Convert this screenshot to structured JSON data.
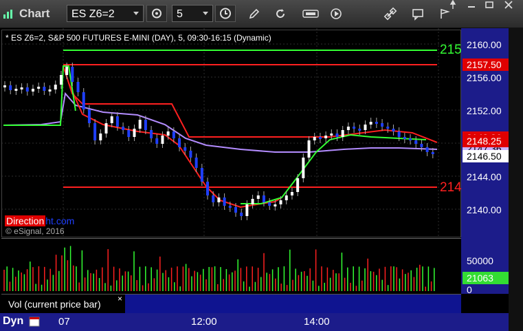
{
  "app": {
    "title": "Chart"
  },
  "toolbar": {
    "symbol": "ES Z6=2",
    "interval": "5",
    "tools": [
      "gear-icon",
      "clock-icon",
      "pencil-icon",
      "refresh-icon",
      "get-icon",
      "play-icon",
      "link-icon",
      "comment-icon"
    ]
  },
  "chart": {
    "legend": "* ES Z6=2, S&P 500 FUTURES E-MINI (DAY), 5, 09:30-16:15 (Dynamic)",
    "watermark_a": "Direction",
    "watermark_b": "ht.com",
    "copyright": "© eSignal, 2016",
    "y_ticks": [
      "2160.00",
      "2156.00",
      "2152.00",
      "2148.00",
      "2144.00",
      "2140.00"
    ],
    "right_edge_labels": {
      "top": "215",
      "bottom": "214"
    },
    "price_tags": [
      {
        "text": "2157.50",
        "bg": "#e00000",
        "fg": "#ffffff"
      },
      {
        "text": "2148.26",
        "bg": "#e00000",
        "fg": "#ffffff"
      },
      {
        "text": "2148.25",
        "bg": "#e00000",
        "fg": "#ffffff"
      },
      {
        "text": "2147.36",
        "bg": "#c9b3ff",
        "fg": "#000000"
      },
      {
        "text": "2146.50",
        "bg": "#ffffff",
        "fg": "#000000"
      }
    ],
    "x_ticks": [
      "07",
      "12:00",
      "14:00"
    ],
    "colors": {
      "green": "#33ff33",
      "red": "#ff2020",
      "purple": "#b38cff",
      "blue": "#1f3fff",
      "white": "#ffffff"
    }
  },
  "volume": {
    "label": "Vol (current price bar)",
    "close": "×",
    "ticks": [
      "50000",
      "0"
    ],
    "last": "21063"
  },
  "bottom": {
    "dyn": "Dyn"
  }
}
